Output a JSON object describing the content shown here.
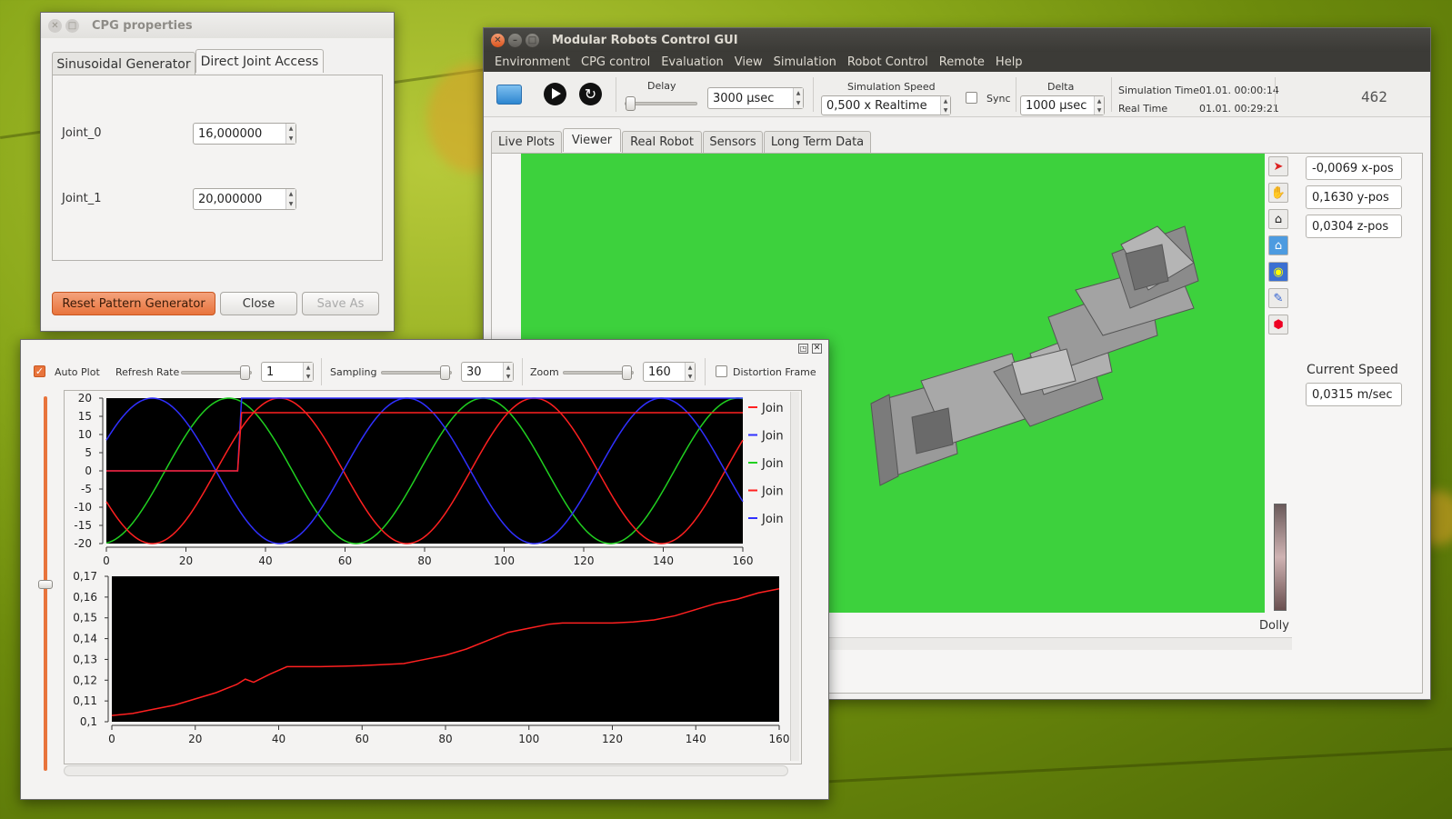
{
  "cpg_window": {
    "title": "CPG properties",
    "tabs": [
      {
        "label": "Sinusoidal Generator"
      },
      {
        "label": "Direct Joint Access"
      }
    ],
    "joints": [
      {
        "label": "Joint_0",
        "value": "16,000000"
      },
      {
        "label": "Joint_1",
        "value": "20,000000"
      }
    ],
    "buttons": {
      "reset": "Reset Pattern Generator",
      "close": "Close",
      "save_as": "Save As"
    }
  },
  "main_window": {
    "title": "Modular Robots Control GUI",
    "menu": [
      "Environment",
      "CPG control",
      "Evaluation",
      "View",
      "Simulation",
      "Robot Control",
      "Remote",
      "Help"
    ],
    "toolbar": {
      "delay_label": "Delay",
      "delay_value": "3000 µsec",
      "sim_speed_label": "Simulation Speed",
      "sim_speed_value": "0,500 x Realtime",
      "sync_label": "Sync",
      "delta_label": "Delta",
      "delta_value": "1000 µsec",
      "sim_time_label": "Simulation Time",
      "sim_time_value": "01.01. 00:00:14",
      "real_time_label": "Real Time",
      "real_time_value": "01.01. 00:29:21",
      "counter": "462"
    },
    "tabs": [
      {
        "label": "Live Plots"
      },
      {
        "label": "Viewer"
      },
      {
        "label": "Real Robot"
      },
      {
        "label": "Sensors"
      },
      {
        "label": "Long Term Data"
      }
    ],
    "viewer": {
      "icons": [
        "pointer-arrow-icon",
        "hand-icon",
        "home-icon",
        "home-blue-icon",
        "eye-icon",
        "flashlight-icon",
        "cube-icon"
      ],
      "x_pos": "-0,0069 x-pos",
      "y_pos": "0,1630 y-pos",
      "z_pos": "0,0304 z-pos",
      "speed_label": "Current Speed",
      "speed_value": "0,0315 m/sec",
      "dolly_label": "Dolly",
      "background_color": "#3dd13d"
    }
  },
  "plot_window": {
    "controls": {
      "auto_plot": "Auto Plot",
      "refresh_rate_label": "Refresh Rate",
      "refresh_rate_value": "1",
      "sampling_label": "Sampling",
      "sampling_value": "30",
      "zoom_label": "Zoom",
      "zoom_value": "160",
      "distortion_label": "Distortion Frame"
    }
  },
  "chart_data": [
    {
      "type": "line",
      "xlim": [
        0,
        160
      ],
      "ylim": [
        -20,
        20
      ],
      "xticks": [
        0,
        20,
        40,
        60,
        80,
        100,
        120,
        140,
        160
      ],
      "yticks": [
        20,
        15,
        10,
        5,
        0,
        -5,
        -10,
        -15,
        -20
      ],
      "legend_labels": [
        "Join",
        "Join",
        "Join",
        "Join",
        "Join"
      ],
      "legend_colors": [
        "#ff2020",
        "#3030ff",
        "#20d020",
        "#ff2020",
        "#3030ff"
      ],
      "series": [
        {
          "color": "#20d020",
          "kind": "sine",
          "amplitude": 20,
          "period": 64,
          "phase_deg": -83
        },
        {
          "color": "#ff2020",
          "kind": "sine",
          "amplitude": 20,
          "period": 64,
          "phase_deg": -155
        },
        {
          "color": "#3030ff",
          "kind": "sine",
          "amplitude": 20,
          "period": 64,
          "phase_deg": 25
        },
        {
          "color": "#3030ff",
          "kind": "step",
          "x": [
            0,
            33,
            34,
            160
          ],
          "y": [
            0,
            0,
            20,
            20
          ]
        },
        {
          "color": "#ff2020",
          "kind": "step",
          "x": [
            0,
            33,
            34,
            160
          ],
          "y": [
            0,
            0,
            16,
            16
          ]
        }
      ]
    },
    {
      "type": "line",
      "xlim": [
        0,
        160
      ],
      "ylim": [
        0.1,
        0.17
      ],
      "xticks": [
        0,
        20,
        40,
        60,
        80,
        100,
        120,
        140,
        160
      ],
      "yticks": [
        "0,17",
        "0,16",
        "0,15",
        "0,14",
        "0,13",
        "0,12",
        "0,11",
        "0,1"
      ],
      "series": [
        {
          "color": "#ff2020",
          "x": [
            0,
            5,
            10,
            15,
            20,
            25,
            30,
            32,
            34,
            38,
            42,
            50,
            60,
            70,
            75,
            80,
            85,
            90,
            95,
            100,
            105,
            108,
            115,
            120,
            125,
            130,
            135,
            140,
            145,
            150,
            155,
            160
          ],
          "y": [
            0.103,
            0.104,
            0.106,
            0.108,
            0.111,
            0.114,
            0.118,
            0.1205,
            0.119,
            0.123,
            0.1265,
            0.1265,
            0.127,
            0.128,
            0.13,
            0.132,
            0.135,
            0.139,
            0.143,
            0.145,
            0.147,
            0.1475,
            0.1475,
            0.1475,
            0.148,
            0.149,
            0.151,
            0.154,
            0.157,
            0.159,
            0.162,
            0.164
          ]
        }
      ]
    }
  ]
}
